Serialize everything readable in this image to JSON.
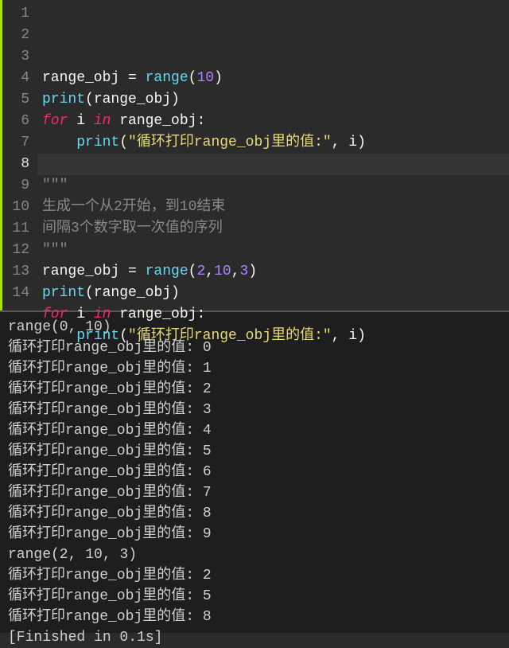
{
  "editor": {
    "lines": [
      {
        "num": "1",
        "segments": [
          [
            "var",
            "range_obj"
          ],
          [
            "paren",
            " = "
          ],
          [
            "fn",
            "range"
          ],
          [
            "paren",
            "("
          ],
          [
            "num",
            "10"
          ],
          [
            "paren",
            ")"
          ]
        ]
      },
      {
        "num": "2",
        "segments": [
          [
            "fn",
            "print"
          ],
          [
            "paren",
            "("
          ],
          [
            "var",
            "range_obj"
          ],
          [
            "paren",
            ")"
          ]
        ]
      },
      {
        "num": "3",
        "segments": [
          [
            "kw",
            "for"
          ],
          [
            "var",
            " i "
          ],
          [
            "kw",
            "in"
          ],
          [
            "var",
            " range_obj"
          ],
          [
            "paren",
            ":"
          ]
        ]
      },
      {
        "num": "4",
        "segments": [
          [
            "var",
            "    "
          ],
          [
            "fn",
            "print"
          ],
          [
            "paren",
            "("
          ],
          [
            "str",
            "\"循环打印range_obj里的值:\""
          ],
          [
            "paren",
            ", "
          ],
          [
            "var",
            "i"
          ],
          [
            "paren",
            ")"
          ]
        ]
      },
      {
        "num": "5",
        "segments": []
      },
      {
        "num": "6",
        "segments": [
          [
            "cmt",
            "\"\"\""
          ]
        ]
      },
      {
        "num": "7",
        "segments": [
          [
            "cmt",
            "生成一个从2开始，到10结束"
          ]
        ]
      },
      {
        "num": "8",
        "segments": [
          [
            "cmt",
            "间隔3个数字取一次值的序列"
          ]
        ]
      },
      {
        "num": "9",
        "segments": [
          [
            "cmt",
            "\"\"\""
          ]
        ]
      },
      {
        "num": "10",
        "segments": [
          [
            "var",
            "range_obj"
          ],
          [
            "paren",
            " = "
          ],
          [
            "fn",
            "range"
          ],
          [
            "paren",
            "("
          ],
          [
            "num",
            "2"
          ],
          [
            "paren",
            ","
          ],
          [
            "num",
            "10"
          ],
          [
            "paren",
            ","
          ],
          [
            "num",
            "3"
          ],
          [
            "paren",
            ")"
          ]
        ]
      },
      {
        "num": "11",
        "segments": [
          [
            "fn",
            "print"
          ],
          [
            "paren",
            "("
          ],
          [
            "var",
            "range_obj"
          ],
          [
            "paren",
            ")"
          ]
        ]
      },
      {
        "num": "12",
        "segments": [
          [
            "kw",
            "for"
          ],
          [
            "var",
            " i "
          ],
          [
            "kw",
            "in"
          ],
          [
            "var",
            " range_obj"
          ],
          [
            "paren",
            ":"
          ]
        ]
      },
      {
        "num": "13",
        "segments": [
          [
            "var",
            "    "
          ],
          [
            "fn",
            "print"
          ],
          [
            "paren",
            "("
          ],
          [
            "str",
            "\"循环打印range_obj里的值:\""
          ],
          [
            "paren",
            ", "
          ],
          [
            "var",
            "i"
          ],
          [
            "paren",
            ")"
          ]
        ]
      },
      {
        "num": "14",
        "segments": []
      }
    ],
    "active_line_index": 7
  },
  "output": {
    "lines": [
      "range(0, 10)",
      "循环打印range_obj里的值: 0",
      "循环打印range_obj里的值: 1",
      "循环打印range_obj里的值: 2",
      "循环打印range_obj里的值: 3",
      "循环打印range_obj里的值: 4",
      "循环打印range_obj里的值: 5",
      "循环打印range_obj里的值: 6",
      "循环打印range_obj里的值: 7",
      "循环打印range_obj里的值: 8",
      "循环打印range_obj里的值: 9",
      "range(2, 10, 3)",
      "循环打印range_obj里的值: 2",
      "循环打印range_obj里的值: 5",
      "循环打印range_obj里的值: 8",
      "[Finished in 0.1s]"
    ]
  }
}
